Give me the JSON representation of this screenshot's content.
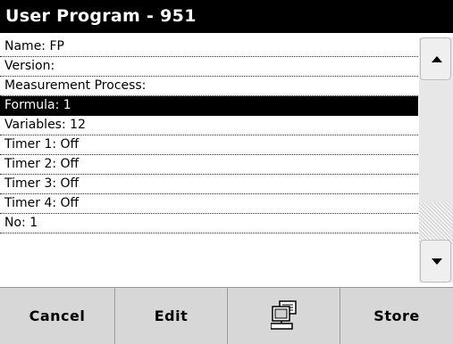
{
  "title": "User Program - 951",
  "rows": [
    {
      "label": "Name: FP",
      "selected": false
    },
    {
      "label": "Version:",
      "selected": false
    },
    {
      "label": "Measurement Process:",
      "selected": false
    },
    {
      "label": "Formula: 1",
      "selected": true
    },
    {
      "label": "Variables: 12",
      "selected": false
    },
    {
      "label": "Timer 1: Off",
      "selected": false
    },
    {
      "label": "Timer 2: Off",
      "selected": false
    },
    {
      "label": "Timer 3: Off",
      "selected": false
    },
    {
      "label": "Timer 4: Off",
      "selected": false
    },
    {
      "label": "No: 1",
      "selected": false
    }
  ],
  "buttons": {
    "cancel": "Cancel",
    "edit": "Edit",
    "computer_icon": "computer-icon",
    "store": "Store"
  },
  "colors": {
    "titlebar_bg": "#000000",
    "selected_row_bg": "#000000",
    "bottombar_bg": "#d7d7d7"
  }
}
